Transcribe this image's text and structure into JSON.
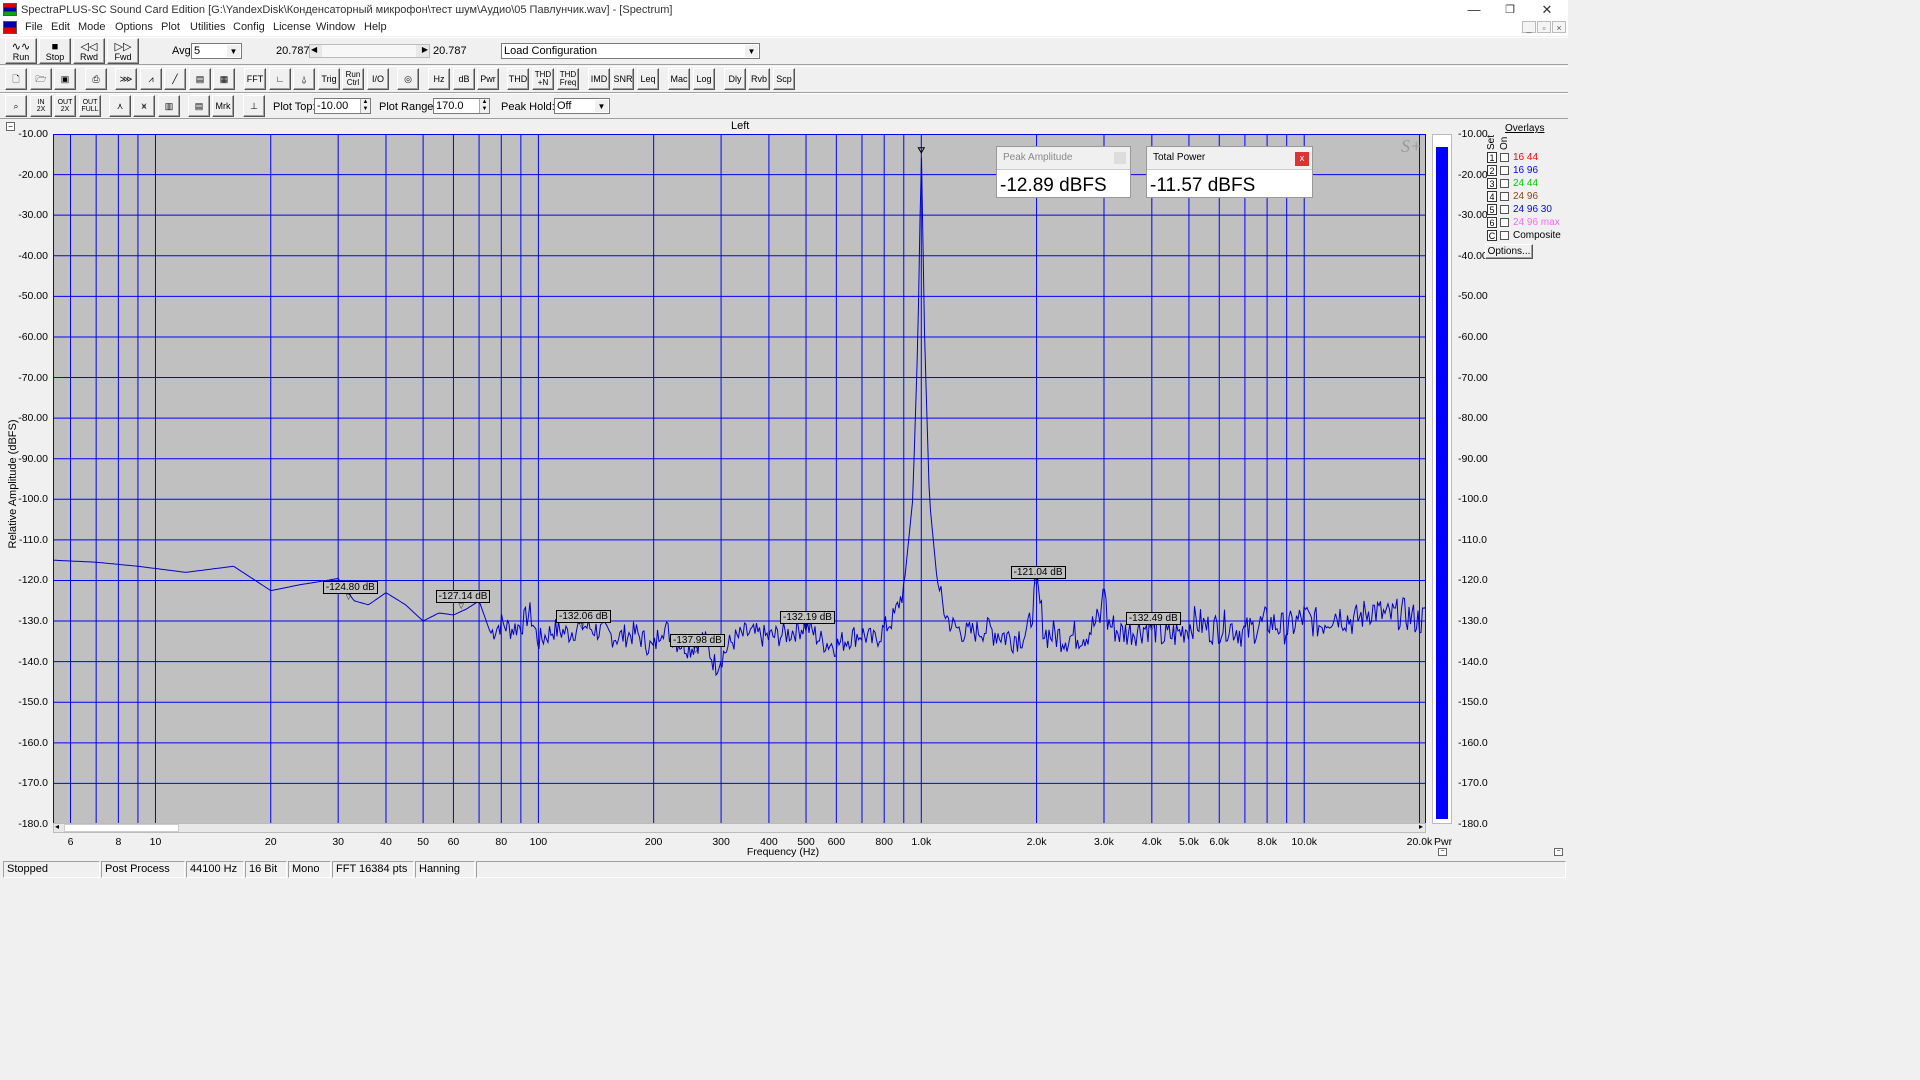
{
  "window": {
    "title": "SpectraPLUS-SC Sound Card Edition [G:\\YandexDisk\\Конденсаторный микрофон\\тест шум\\Аудио\\05 Павлунчик.wav] - [Spectrum]",
    "minimize": "—",
    "restore": "❐",
    "close": "✕"
  },
  "menu": [
    "File",
    "Edit",
    "Mode",
    "Options",
    "Plot",
    "Utilities",
    "Config",
    "License",
    "Window",
    "Help"
  ],
  "toolbar1": {
    "run": "Run",
    "stop": "Stop",
    "rwd": "Rwd",
    "fwd": "Fwd",
    "avg_label": "Avg",
    "avg_value": "5",
    "time_left": "20.787",
    "time_right": "20.787",
    "config_value": "Load Configuration"
  },
  "toolbar2": [
    "FFT",
    "Trig",
    "Run\nCtrl",
    "I/O",
    "Hz",
    "dB",
    "Pwr",
    "THD",
    "THD\n+N",
    "THD\nFreq",
    "IMD",
    "SNR",
    "Leq",
    "Mac",
    "Log",
    "Dly",
    "Rvb",
    "Scp"
  ],
  "toolbar3": {
    "buttons": [
      "Mrk"
    ],
    "plot_top_label": "Plot Top:",
    "plot_top_value": "-10.00",
    "plot_range_label": "Plot Range:",
    "plot_range_value": "170.0",
    "peak_hold_label": "Peak Hold:",
    "peak_hold_value": "Off"
  },
  "meters": {
    "peak_amplitude": {
      "title": "Peak Amplitude",
      "value": "-12.89 dBFS"
    },
    "total_power": {
      "title": "Total Power",
      "value": "-11.57 dBFS",
      "close": "x"
    }
  },
  "overlays": {
    "title": "Overlays",
    "set_label": "Set",
    "on_label": "On",
    "items": [
      {
        "num": "1",
        "label": "16 44",
        "color": "#ff0000"
      },
      {
        "num": "2",
        "label": "16 96",
        "color": "#0000ff"
      },
      {
        "num": "3",
        "label": "24 44",
        "color": "#00cc00"
      },
      {
        "num": "4",
        "label": "24 96",
        "color": "#8b4513"
      },
      {
        "num": "5",
        "label": "24 96 30",
        "color": "#0000ff"
      },
      {
        "num": "6",
        "label": "24 96 max",
        "color": "#ff66ff"
      },
      {
        "num": "C",
        "label": "Composite",
        "color": "#000000"
      }
    ],
    "options_button": "Options..."
  },
  "chart_data": {
    "type": "line",
    "title": "Left",
    "xlabel": "Frequency (Hz)",
    "ylabel": "Relative Amplitude (dBFS)",
    "x_scale": "log",
    "xlim": [
      5.4,
      20800
    ],
    "ylim": [
      -180,
      -10
    ],
    "grid": true,
    "series_color": "#0000cc",
    "grid_color": "#0000ff",
    "x_ticks": [
      6,
      8,
      10,
      20,
      30,
      40,
      50,
      60,
      80,
      100,
      200,
      300,
      400,
      500,
      600,
      800,
      1000,
      2000,
      3000,
      4000,
      5000,
      6000,
      8000,
      10000,
      20000
    ],
    "x_tick_labels": [
      "6",
      "8",
      "10",
      "20",
      "30",
      "40",
      "50",
      "60",
      "80",
      "100",
      "200",
      "300",
      "400",
      "500",
      "600",
      "800",
      "1.0k",
      "2.0k",
      "3.0k",
      "4.0k",
      "5.0k",
      "6.0k",
      "8.0k",
      "10.0k",
      "20.0k"
    ],
    "y_ticks": [
      -10,
      -20,
      -30,
      -40,
      -50,
      -60,
      -70,
      -80,
      -90,
      -100,
      -110,
      -120,
      -130,
      -140,
      -150,
      -160,
      -170,
      -180
    ],
    "y_tick_labels": [
      "-10.00",
      "-20.00",
      "-30.00",
      "-40.00",
      "-50.00",
      "-60.00",
      "-70.00",
      "-80.00",
      "-90.00",
      "-100.0",
      "-110.0",
      "-120.0",
      "-130.0",
      "-140.0",
      "-150.0",
      "-160.0",
      "-170.0",
      "-180.0"
    ],
    "right_y_tick_labels": [
      "-10.00",
      "-20.00",
      "-30.00",
      "-40.00",
      "-50.00",
      "-60.00",
      "-70.00",
      "-80.00",
      "-90.00",
      "-100.0",
      "-110.0",
      "-120.0",
      "-130.0",
      "-140.0",
      "-150.0",
      "-160.0",
      "-170.0",
      "-180.0"
    ],
    "points": [
      [
        5.4,
        -115
      ],
      [
        7,
        -115.5
      ],
      [
        9,
        -116.5
      ],
      [
        12,
        -118
      ],
      [
        16,
        -116.5
      ],
      [
        20,
        -122.5
      ],
      [
        24,
        -121
      ],
      [
        28,
        -120
      ],
      [
        30,
        -119.5
      ],
      [
        33,
        -125
      ],
      [
        36,
        -126
      ],
      [
        40,
        -123
      ],
      [
        45,
        -126
      ],
      [
        50,
        -130
      ],
      [
        55,
        -128
      ],
      [
        60,
        -128.5
      ],
      [
        65,
        -127
      ],
      [
        70,
        -125
      ],
      [
        75,
        -133
      ],
      [
        80,
        -130.5
      ],
      [
        85,
        -132
      ],
      [
        90,
        -131
      ],
      [
        95,
        -128
      ],
      [
        100,
        -135
      ],
      [
        110,
        -132
      ],
      [
        120,
        -133
      ],
      [
        130,
        -131
      ],
      [
        140,
        -132
      ],
      [
        160,
        -134
      ],
      [
        180,
        -133
      ],
      [
        200,
        -137
      ],
      [
        210,
        -131
      ],
      [
        230,
        -135
      ],
      [
        250,
        -136.5
      ],
      [
        270,
        -134
      ],
      [
        290,
        -141
      ],
      [
        320,
        -135
      ],
      [
        350,
        -133
      ],
      [
        400,
        -134
      ],
      [
        450,
        -133
      ],
      [
        500,
        -131
      ],
      [
        550,
        -135
      ],
      [
        600,
        -136
      ],
      [
        650,
        -134
      ],
      [
        700,
        -133
      ],
      [
        750,
        -135
      ],
      [
        800,
        -132
      ],
      [
        850,
        -129
      ],
      [
        900,
        -122
      ],
      [
        950,
        -100
      ],
      [
        980,
        -60
      ],
      [
        1000,
        -12.89
      ],
      [
        1020,
        -60
      ],
      [
        1050,
        -100
      ],
      [
        1100,
        -120
      ],
      [
        1150,
        -128
      ],
      [
        1200,
        -131
      ],
      [
        1300,
        -133
      ],
      [
        1500,
        -132
      ],
      [
        1700,
        -134
      ],
      [
        1900,
        -133
      ],
      [
        2000,
        -121
      ],
      [
        2100,
        -133
      ],
      [
        2400,
        -134
      ],
      [
        2700,
        -133
      ],
      [
        2950,
        -129
      ],
      [
        3000,
        -118
      ],
      [
        3050,
        -130
      ],
      [
        3300,
        -133
      ],
      [
        3700,
        -132
      ],
      [
        4000,
        -131
      ],
      [
        4300,
        -134
      ],
      [
        4700,
        -133
      ],
      [
        5200,
        -130
      ],
      [
        5700,
        -132
      ],
      [
        6300,
        -131
      ],
      [
        7000,
        -133
      ],
      [
        8000,
        -130
      ],
      [
        9000,
        -132
      ],
      [
        10000,
        -129
      ],
      [
        11000,
        -131
      ],
      [
        12000,
        -128
      ],
      [
        13500,
        -130
      ],
      [
        15000,
        -127
      ],
      [
        16500,
        -129
      ],
      [
        18000,
        -128
      ],
      [
        20000,
        -130
      ],
      [
        20800,
        -129
      ]
    ],
    "markers": [
      {
        "label": "-124.80 dB",
        "x": 32,
        "y": -124.8
      },
      {
        "label": "-127.14 dB",
        "x": 63,
        "y": -127.14
      },
      {
        "label": "-132.06 dB",
        "x": 130,
        "y": -132.06
      },
      {
        "label": "-137.98 dB",
        "x": 258,
        "y": -137.98
      },
      {
        "label": "-132.19 dB",
        "x": 500,
        "y": -132.19
      },
      {
        "label": "-121.04 dB",
        "x": 2000,
        "y": -121.04
      },
      {
        "label": "-132.49 dB",
        "x": 4000,
        "y": -132.49
      }
    ],
    "power_bar": {
      "label": "Pwr",
      "level_dbfs": -11.57
    }
  },
  "statusbar": [
    "Stopped",
    "Post Process",
    "44100 Hz",
    "16 Bit",
    "Mono",
    "FFT 16384 pts",
    "Hanning"
  ]
}
